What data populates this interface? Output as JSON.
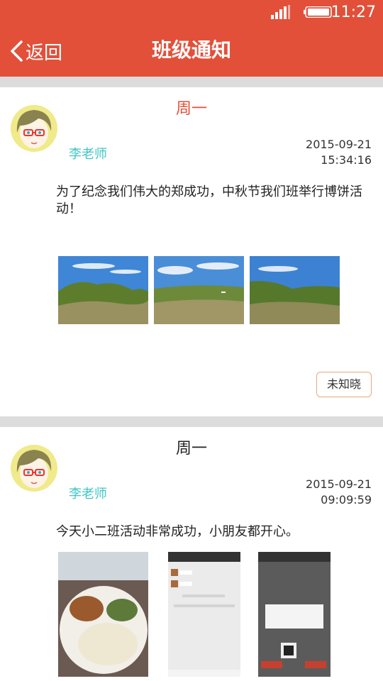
{
  "status_bar": {
    "time": "11:27",
    "signal_icon": "signal-icon",
    "battery_icon": "battery-icon"
  },
  "nav": {
    "back_label": "返回",
    "title": "班级通知",
    "back_icon": "chevron-left-icon"
  },
  "colors": {
    "header": "#e2503a",
    "teacher_name": "#3fc7c4",
    "weekday_highlight": "#e2503a"
  },
  "notices": [
    {
      "weekday": "周一",
      "teacher": "李老师",
      "date": "2015-09-21",
      "time": "15:34:16",
      "content": "为了纪念我们伟大的郑成功，中秋节我们班举行博饼活动！",
      "photo_count": 3,
      "status_button": "未知晓"
    },
    {
      "weekday": "周一",
      "teacher": "李老师",
      "date": "2015-09-21",
      "time": "09:09:59",
      "content": "今天小二班活动非常成功，小朋友都开心。",
      "photo_count": 3
    }
  ]
}
